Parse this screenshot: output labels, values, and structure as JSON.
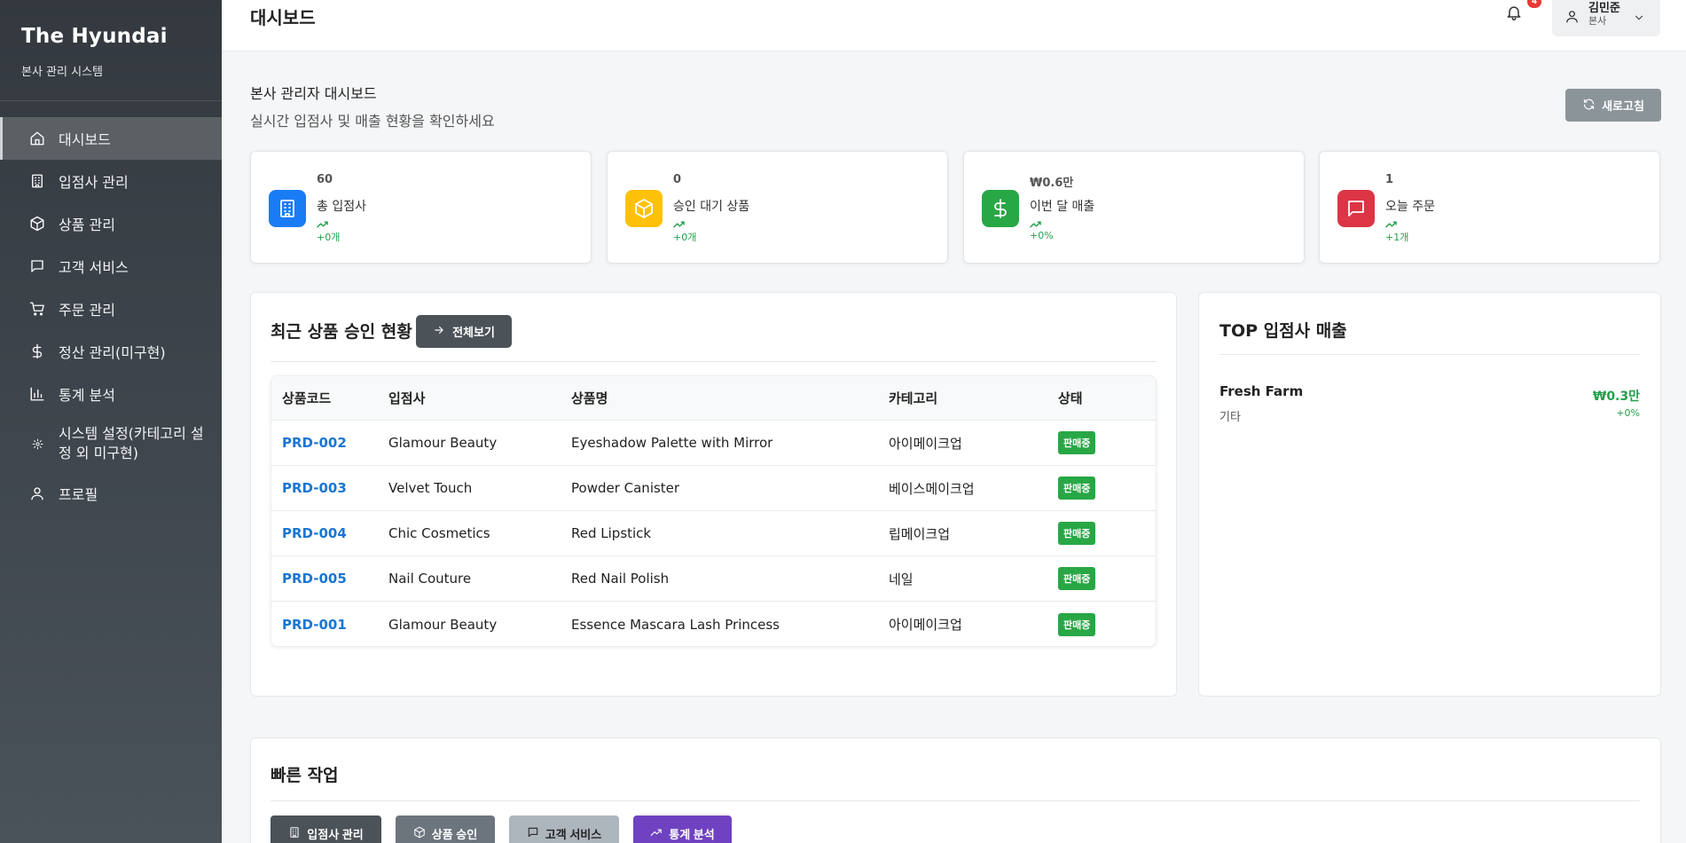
{
  "sidebar": {
    "brand_title": "The Hyundai",
    "brand_sub": "본사 관리 시스템",
    "items": [
      {
        "label": "대시보드",
        "icon": "home-icon"
      },
      {
        "label": "입점사 관리",
        "icon": "building-icon"
      },
      {
        "label": "상품 관리",
        "icon": "box-icon"
      },
      {
        "label": "고객 서비스",
        "icon": "message-icon"
      },
      {
        "label": "주문 관리",
        "icon": "cart-icon"
      },
      {
        "label": "정산 관리(미구현)",
        "icon": "dollar-icon"
      },
      {
        "label": "통계 분석",
        "icon": "bar-chart-icon"
      },
      {
        "label": "시스템 설정(카테고리 설정 외 미구현)",
        "icon": "gear-icon"
      },
      {
        "label": "프로필",
        "icon": "user-icon"
      }
    ]
  },
  "header": {
    "title": "대시보드",
    "notification_count": "4",
    "user_name": "김민준",
    "user_role": "본사"
  },
  "intro": {
    "title": "본사 관리자 대시보드",
    "subtitle": "실시간 입점사 및 매출 현황을 확인하세요",
    "refresh_label": "새로고침"
  },
  "stats": [
    {
      "value": "60",
      "label": "총 입점사",
      "change": "+0개",
      "color": "#1a7cf5",
      "icon": "building-icon"
    },
    {
      "value": "0",
      "label": "승인 대기 상품",
      "change": "+0개",
      "color": "#ffc107",
      "icon": "box-icon"
    },
    {
      "value": "₩0.6만",
      "label": "이번 달 매출",
      "change": "+0%",
      "color": "#28a745",
      "icon": "dollar-icon"
    },
    {
      "value": "1",
      "label": "오늘 주문",
      "change": "+1개",
      "color": "#dc3545",
      "icon": "message-icon"
    }
  ],
  "approvals": {
    "title": "최근 상품 승인 현황",
    "view_all_label": "전체보기",
    "columns": [
      "상품코드",
      "입점사",
      "상품명",
      "카테고리",
      "상태"
    ],
    "rows": [
      {
        "code": "PRD-002",
        "vendor": "Glamour Beauty",
        "product": "Eyeshadow Palette with Mirror",
        "category": "아이메이크업",
        "status": "판매중"
      },
      {
        "code": "PRD-003",
        "vendor": "Velvet Touch",
        "product": "Powder Canister",
        "category": "베이스메이크업",
        "status": "판매중"
      },
      {
        "code": "PRD-004",
        "vendor": "Chic Cosmetics",
        "product": "Red Lipstick",
        "category": "립메이크업",
        "status": "판매중"
      },
      {
        "code": "PRD-005",
        "vendor": "Nail Couture",
        "product": "Red Nail Polish",
        "category": "네일",
        "status": "판매중"
      },
      {
        "code": "PRD-001",
        "vendor": "Glamour Beauty",
        "product": "Essence Mascara Lash Princess",
        "category": "아이메이크업",
        "status": "판매중"
      }
    ]
  },
  "top_vendors": {
    "title": "TOP 입점사 매출",
    "items": [
      {
        "name": "Fresh Farm",
        "category": "기타",
        "amount": "₩0.3만",
        "change": "+0%"
      }
    ]
  },
  "quick_actions": {
    "title": "빠른 작업",
    "buttons": [
      {
        "label": "입점사 관리",
        "color": "#4b5258",
        "icon": "building-icon"
      },
      {
        "label": "상품 승인",
        "color": "#6c757d",
        "icon": "box-icon"
      },
      {
        "label": "고객 서비스",
        "color": "#adb5bd",
        "icon": "message-icon"
      },
      {
        "label": "통계 분석",
        "color": "#6f42c1",
        "icon": "trend-up-icon"
      }
    ]
  }
}
